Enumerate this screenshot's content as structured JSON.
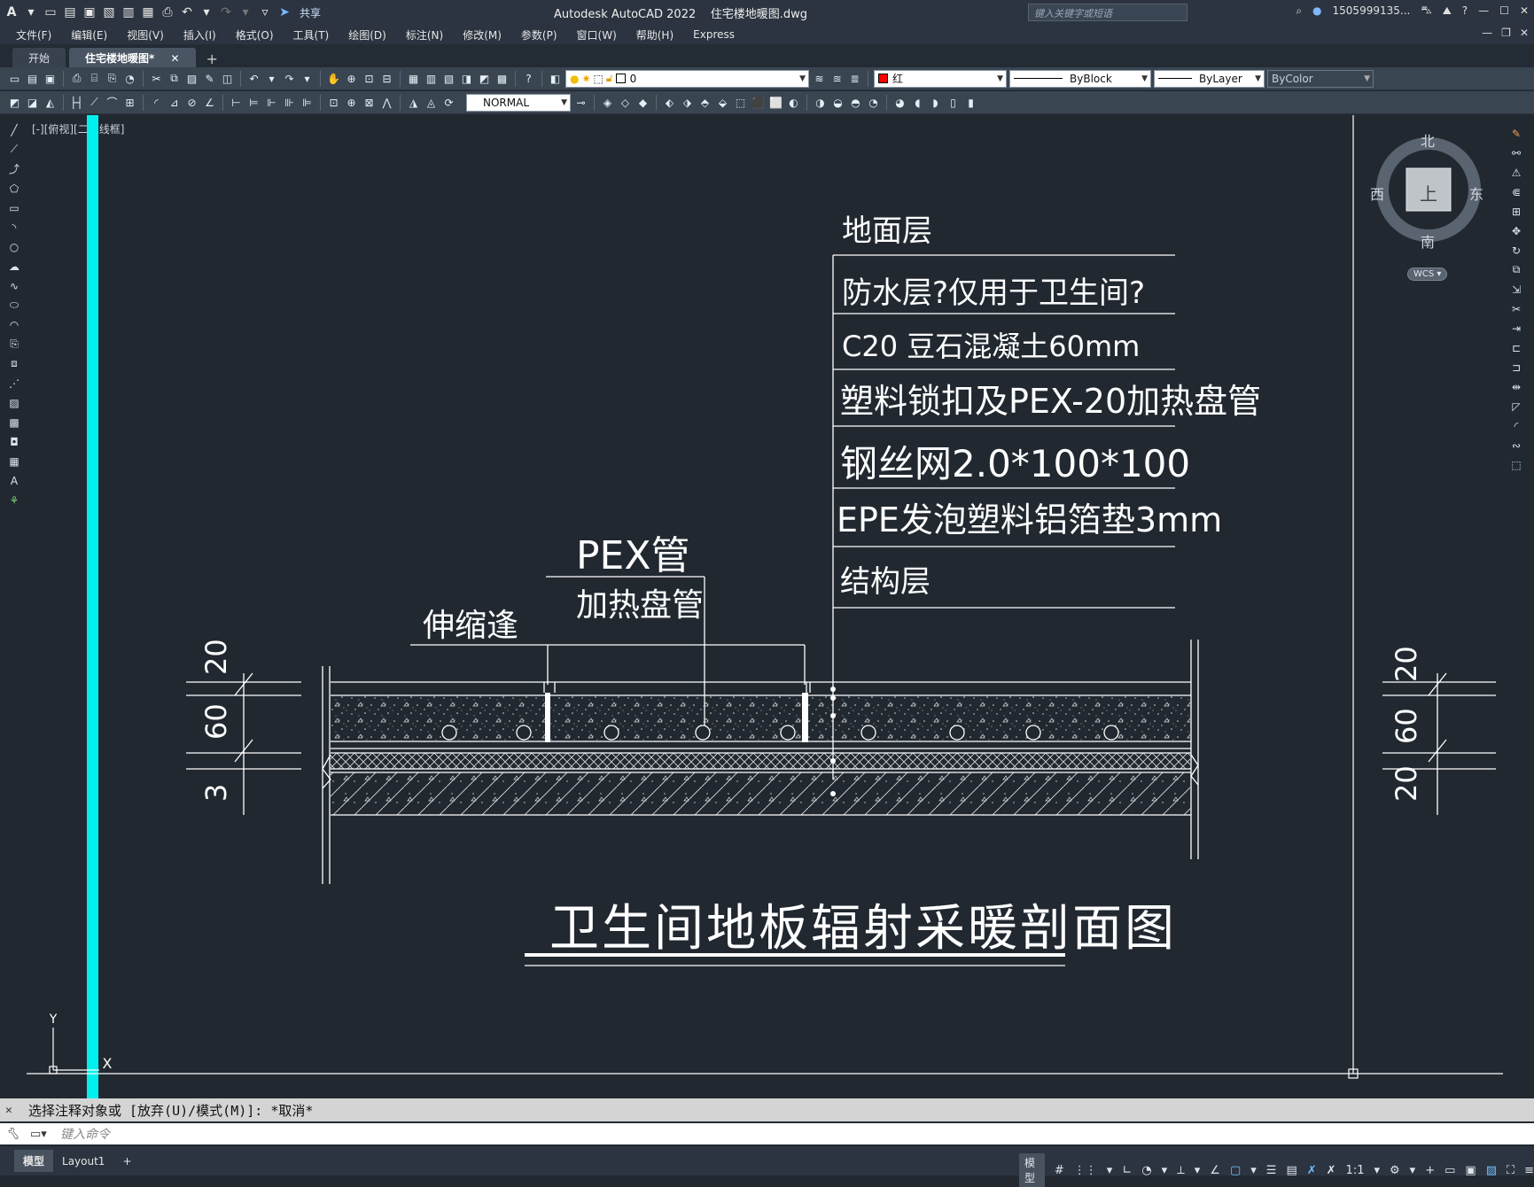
{
  "app": {
    "title": "Autodesk AutoCAD 2022",
    "filename": "住宅楼地暖图.dwg",
    "share_label": "共享",
    "search_placeholder": "键入关键字或短语",
    "user": "1505999135...",
    "logo": "A"
  },
  "menu": [
    "文件(F)",
    "编辑(E)",
    "视图(V)",
    "插入(I)",
    "格式(O)",
    "工具(T)",
    "绘图(D)",
    "标注(N)",
    "修改(M)",
    "参数(P)",
    "窗口(W)",
    "帮助(H)",
    "Express"
  ],
  "tabs": [
    "开始",
    "住宅楼地暖图*"
  ],
  "toolbar": {
    "layer": "0",
    "color": "红",
    "linetype": "ByBlock",
    "lineweight": "ByLayer",
    "plotstyle": "ByColor",
    "dimstyle": "NORMAL"
  },
  "viewport": {
    "label": "[-][俯视][二维线框]",
    "compass": {
      "north": "北",
      "south": "南",
      "east": "东",
      "west": "西",
      "top": "上"
    },
    "wcs": "WCS",
    "ucs_y": "Y",
    "ucs_x": "X"
  },
  "drawing": {
    "layers": [
      "地面层",
      "防水层?仅用于卫生间?",
      "C20 豆石混凝土60mm",
      "塑料锁扣及PEX-20加热盘管",
      "钢丝网2.0*100*100",
      "EPE发泡塑料铝箔垫3mm",
      "结构层"
    ],
    "pex_label": "PEX管",
    "heating_label": "加热盘管",
    "joint_label": "伸缩逢",
    "title": "卫生间地板辐射采暖剖面图",
    "dims_left": [
      "20",
      "60",
      "3"
    ],
    "dims_right": [
      "20",
      "60",
      "20"
    ]
  },
  "command": {
    "history": "选择注释对象或 [放弃(U)/模式(M)]: *取消*",
    "placeholder": "键入命令"
  },
  "status": {
    "tabs": [
      "模型",
      "Layout1"
    ],
    "model": "模型",
    "scale": "1:1"
  }
}
